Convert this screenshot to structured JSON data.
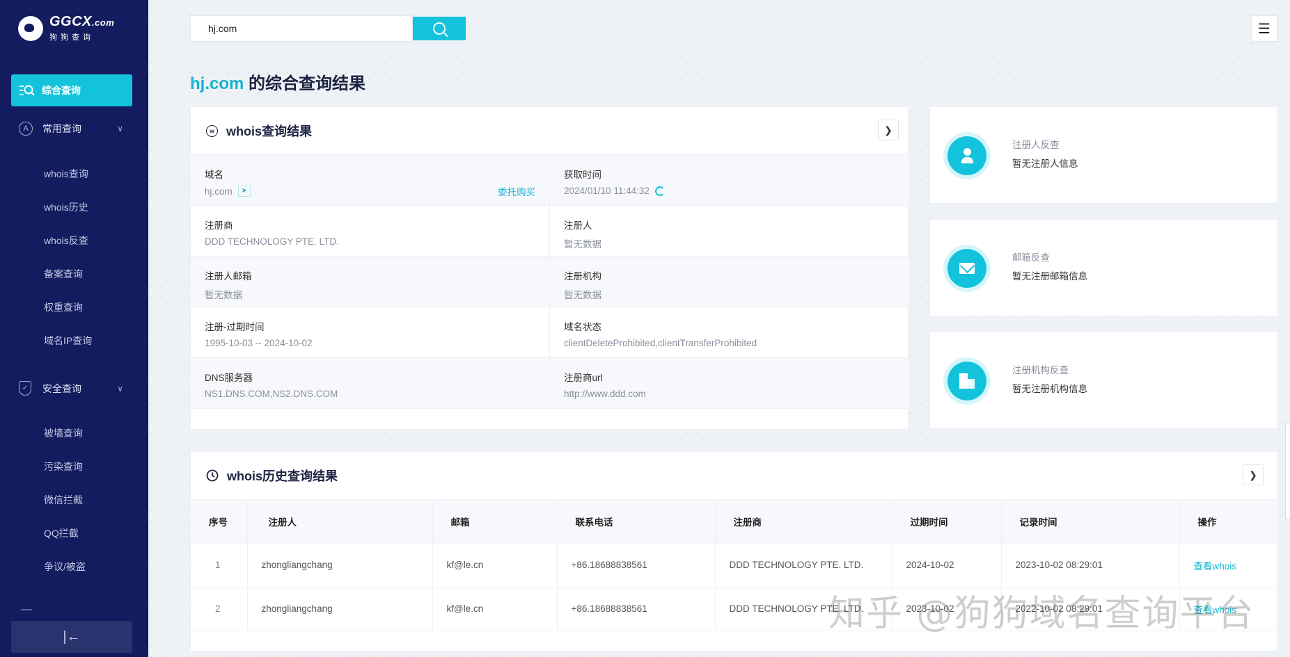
{
  "logo": {
    "main": "GGCX",
    "suffix": ".com",
    "sub": "狗狗查询"
  },
  "sidebar": {
    "active": "综合查询",
    "groups": [
      {
        "label": "常用查询",
        "icon": "a-circle-icon",
        "items": [
          "whois查询",
          "whois历史",
          "whois反查",
          "备案查询",
          "权重查询",
          "域名IP查询"
        ]
      },
      {
        "label": "安全查询",
        "icon": "shield-icon",
        "items": [
          "被墙查询",
          "污染查询",
          "微信拦截",
          "QQ拦截",
          "争议/被盗"
        ]
      }
    ],
    "collapse_icon": "collapse-left-icon"
  },
  "search": {
    "value": "hj.com"
  },
  "page_title": {
    "domain": "hj.com",
    "suffix": " 的综合查询结果"
  },
  "whois": {
    "title": "whois查询结果",
    "buy_label": "委托购买",
    "fields": [
      {
        "label": "域名",
        "value": "hj.com"
      },
      {
        "label": "获取时间",
        "value": "2024/01/10 11:44:32"
      },
      {
        "label": "注册商",
        "value": "DDD TECHNOLOGY PTE. LTD."
      },
      {
        "label": "注册人",
        "value": "暂无数据"
      },
      {
        "label": "注册人邮箱",
        "value": "暂无数据"
      },
      {
        "label": "注册机构",
        "value": "暂无数据"
      },
      {
        "label": "注册-过期时间",
        "value": "1995-10-03 -- 2024-10-02"
      },
      {
        "label": "域名状态",
        "value": "clientDeleteProhibited,clientTransferProhibited"
      },
      {
        "label": "DNS服务器",
        "value": "NS1.DNS.COM,NS2.DNS.COM"
      },
      {
        "label": "注册商url",
        "value": "http://www.ddd.com"
      }
    ]
  },
  "reverse": [
    {
      "title": "注册人反查",
      "value": "暂无注册人信息",
      "icon": "person-icon"
    },
    {
      "title": "邮箱反查",
      "value": "暂无注册邮箱信息",
      "icon": "mail-icon"
    },
    {
      "title": "注册机构反查",
      "value": "暂无注册机构信息",
      "icon": "building-icon"
    }
  ],
  "history": {
    "title": "whois历史查询结果",
    "columns": [
      "序号",
      "注册人",
      "邮箱",
      "联系电话",
      "注册商",
      "过期时间",
      "记录时间",
      "操作"
    ],
    "rows": [
      [
        "1",
        "zhongliangchang",
        "kf@le.cn",
        "+86.18688838561",
        "DDD TECHNOLOGY PTE. LTD.",
        "2024-10-02",
        "2023-10-02 08:29:01",
        "查看whois"
      ],
      [
        "2",
        "zhongliangchang",
        "kf@le.cn",
        "+86.18688838561",
        "DDD TECHNOLOGY PTE. LTD.",
        "2023-10-02",
        "2022-10-02 08:29:01",
        "查看whois"
      ]
    ]
  },
  "watermark": "知乎 @狗狗域名查询平台",
  "colors": {
    "sidebar": "#121c5e",
    "accent": "#13c3db",
    "background": "#eef1f6"
  }
}
